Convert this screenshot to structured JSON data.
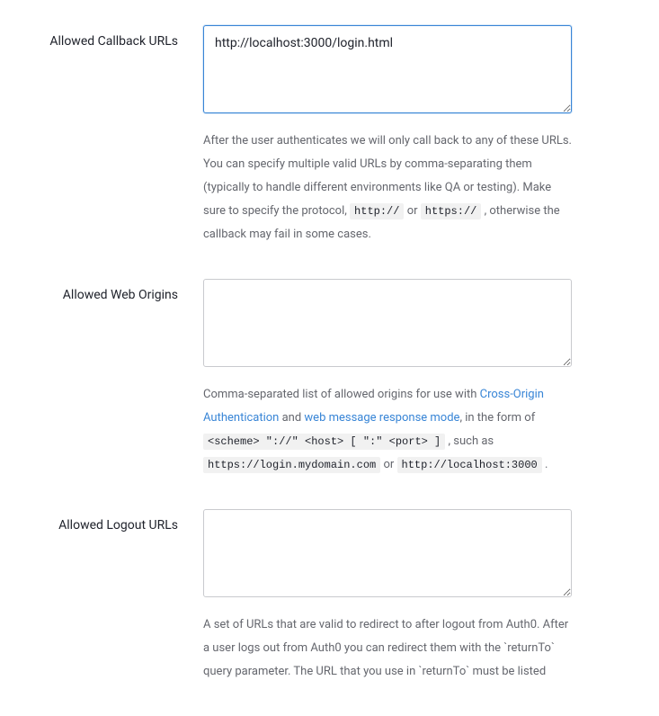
{
  "fields": {
    "callback": {
      "label": "Allowed Callback URLs",
      "value": "http://localhost:3000/login.html",
      "help_pre": "After the user authenticates we will only call back to any of these URLs. You can specify multiple valid URLs by comma-separating them (typically to handle different environments like QA or testing). Make sure to specify the protocol, ",
      "code_http": "http://",
      "or_text": " or ",
      "code_https": "https://",
      "help_post": " , otherwise the callback may fail in some cases."
    },
    "origins": {
      "label": "Allowed Web Origins",
      "value": "",
      "help_pre": "Comma-separated list of allowed origins for use with ",
      "link1": "Cross-Origin Authentication",
      "and_text": " and ",
      "link2": "web message response mode",
      "help_mid": ", in the form of ",
      "code_form": "<scheme> \"://\" <host> [ \":\" <port> ]",
      "such_as": " , such as ",
      "code_ex1": "https://login.mydomain.com",
      "or_text": " or ",
      "code_ex2": "http://localhost:3000",
      "period": " ."
    },
    "logout": {
      "label": "Allowed Logout URLs",
      "value": "",
      "help": "A set of URLs that are valid to redirect to after logout from Auth0. After a user logs out from Auth0 you can redirect them with the `returnTo` query parameter. The URL that you use in `returnTo` must be listed"
    }
  }
}
